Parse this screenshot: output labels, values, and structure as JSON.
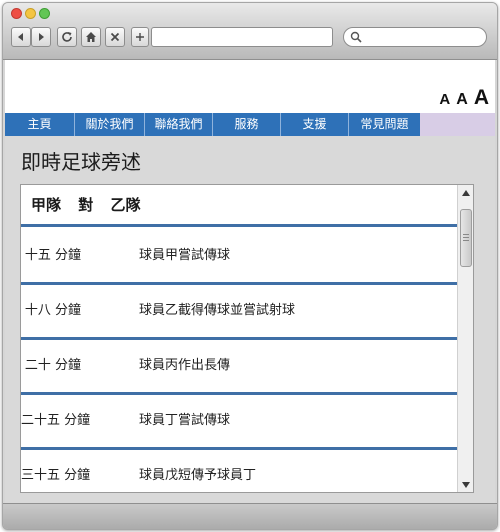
{
  "browser": {
    "url": "",
    "search_placeholder": "",
    "buttons": [
      "back",
      "forward",
      "reload",
      "home",
      "stop",
      "new-tab"
    ]
  },
  "font_size_controls": {
    "small": "A",
    "medium": "A",
    "large": "A"
  },
  "nav": {
    "items": [
      {
        "label": "主頁"
      },
      {
        "label": "關於我們"
      },
      {
        "label": "聯絡我們"
      },
      {
        "label": "服務"
      },
      {
        "label": "支援"
      },
      {
        "label": "常見問題"
      }
    ]
  },
  "page": {
    "title": "即時足球旁述",
    "match": {
      "team_a": "甲隊",
      "versus": "對",
      "team_b": "乙隊"
    },
    "entries": [
      {
        "time": "十五 分鐘",
        "text": "球員甲嘗試傳球"
      },
      {
        "time": "十八 分鐘",
        "text": "球員乙截得傳球並嘗試射球"
      },
      {
        "time": "二十 分鐘",
        "text": "球員丙作出長傳"
      },
      {
        "time": "二十五 分鐘",
        "text": "球員丁嘗試傳球"
      },
      {
        "time": "三十五 分鐘",
        "text": "球員戊短傳予球員丁"
      }
    ]
  },
  "colors": {
    "nav_blue": "#2e71b8",
    "nav_tail": "#d8cde6",
    "entry_divider": "#3f6fa6"
  }
}
